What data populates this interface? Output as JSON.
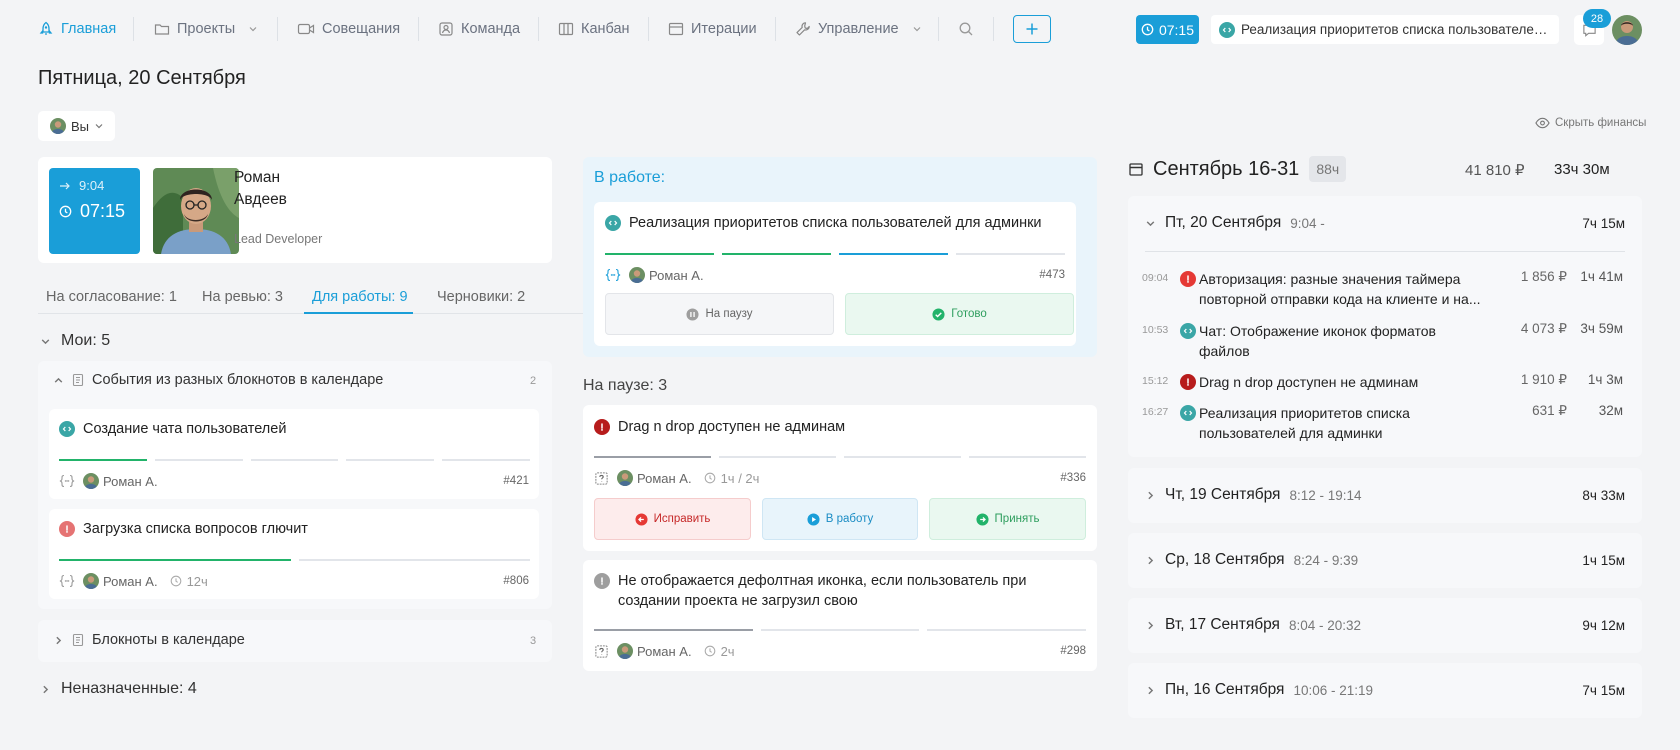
{
  "nav": {
    "home": "Главная",
    "projects": "Проекты",
    "meetings": "Совещания",
    "team": "Команда",
    "kanban": "Канбан",
    "iterations": "Итерации",
    "management": "Управление",
    "timer": "07:15",
    "current_task": "Реализация приоритетов списка пользователей для админки",
    "notifications": "28"
  },
  "page": {
    "title": "Пятница, 20 Сентября",
    "filter": "Вы",
    "hide_finance": "Скрыть финансы"
  },
  "profile": {
    "start_time": "9:04",
    "worked": "07:15",
    "first_name": "Роман",
    "last_name": "Авдеев",
    "role": "Lead Developer"
  },
  "tabs": [
    {
      "label": "На согласование: 1"
    },
    {
      "label": "На ревью: 3"
    },
    {
      "label": "Для работы: 9"
    },
    {
      "label": "Черновики: 2"
    }
  ],
  "mine": {
    "heading": "Мои: 5",
    "group1": {
      "title": "События из разных блокнотов в календаре",
      "count": "2",
      "tasks": [
        {
          "title": "Создание чата пользователей",
          "assignee": "Роман А.",
          "number": "#421",
          "progress": [
            1,
            0,
            0,
            0,
            0
          ]
        },
        {
          "title": "Загрузка списка вопросов глючит",
          "assignee": "Роман А.",
          "estimate": "12ч",
          "number": "#806",
          "progress": [
            1,
            0
          ]
        }
      ]
    },
    "group2": {
      "title": "Блокноты в календаре",
      "count": "3"
    },
    "unassigned": "Неназначенные: 4"
  },
  "in_work": {
    "heading": "В работе:",
    "task": {
      "title": "Реализация приоритетов списка пользователей для админки",
      "assignee": "Роман А.",
      "number": "#473",
      "progress": [
        1,
        1,
        2,
        0
      ]
    },
    "pause_btn": "На паузу",
    "done_btn": "Готово"
  },
  "paused": {
    "heading": "На паузе: 3",
    "tasks": [
      {
        "title": "Drag n drop доступен не админам",
        "assignee": "Роман А.",
        "estimate": "1ч / 2ч",
        "number": "#336",
        "progress": [
          3,
          0,
          0,
          0
        ]
      },
      {
        "title": "Не отображается дефолтная иконка, если пользователь при создании проекта не загрузил свою",
        "assignee": "Роман А.",
        "estimate": "2ч",
        "number": "#298",
        "progress": [
          3,
          0,
          0
        ]
      }
    ],
    "fix_btn": "Исправить",
    "work_btn": "В работу",
    "accept_btn": "Принять"
  },
  "calendar": {
    "period": "Сентябрь 16-31",
    "hours": "88ч",
    "money": "41 810 ₽",
    "total": "33ч 30м",
    "days": [
      {
        "label": "Пт, 20 Сентября",
        "range": "9:04 -",
        "total": "7ч 15м",
        "expanded": true
      },
      {
        "label": "Чт, 19 Сентября",
        "range": "8:12 - 19:14",
        "total": "8ч 33м"
      },
      {
        "label": "Ср, 18 Сентября",
        "range": "8:24 - 9:39",
        "total": "1ч 15м"
      },
      {
        "label": "Вт, 17 Сентября",
        "range": "8:04 - 20:32",
        "total": "9ч 12м"
      },
      {
        "label": "Пн, 16 Сентября",
        "range": "10:06 - 21:19",
        "total": "7ч 15м"
      }
    ],
    "entries": [
      {
        "time": "09:04",
        "type": "bug",
        "title": "Авторизация: разные значения таймера повторной отправки кода на клиенте и на...",
        "money": "1 856 ₽",
        "duration": "1ч 41м"
      },
      {
        "time": "10:53",
        "type": "code",
        "title": "Чат: Отображение иконок форматов файлов",
        "money": "4 073 ₽",
        "duration": "3ч 59м"
      },
      {
        "time": "15:12",
        "type": "critical",
        "title": "Drag n drop доступен не админам",
        "money": "1 910 ₽",
        "duration": "1ч 3м"
      },
      {
        "time": "16:27",
        "type": "code",
        "title": "Реализация приоритетов списка пользователей для админки",
        "money": "631 ₽",
        "duration": "32м"
      }
    ]
  },
  "colors": {
    "accent": "#1a9ed8",
    "success": "#22b36a",
    "danger": "#e53935",
    "critical": "#b71c1c",
    "code": "#3aa6a6"
  }
}
